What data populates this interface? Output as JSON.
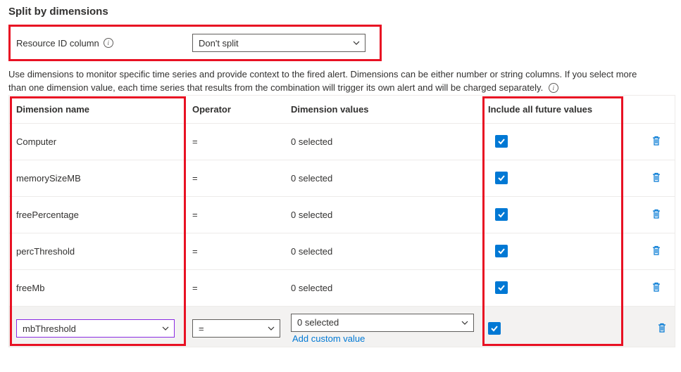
{
  "section_title": "Split by dimensions",
  "resource_id_label": "Resource ID column",
  "resource_id_value": "Don't split",
  "help_text_1": "Use dimensions to monitor specific time series and provide context to the fired alert. Dimensions can be either number or string columns. If you select more",
  "help_text_2": "than one dimension value, each time series that results from the combination will trigger its own alert and will be charged separately.",
  "headers": {
    "name": "Dimension name",
    "operator": "Operator",
    "values": "Dimension values",
    "include": "Include all future values"
  },
  "rows": [
    {
      "name": "Computer",
      "operator": "=",
      "values": "0 selected",
      "include": true
    },
    {
      "name": "memorySizeMB",
      "operator": "=",
      "values": "0 selected",
      "include": true
    },
    {
      "name": "freePercentage",
      "operator": "=",
      "values": "0 selected",
      "include": true
    },
    {
      "name": "percThreshold",
      "operator": "=",
      "values": "0 selected",
      "include": true
    },
    {
      "name": "freeMb",
      "operator": "=",
      "values": "0 selected",
      "include": true
    }
  ],
  "edit_row": {
    "name": "mbThreshold",
    "operator": "=",
    "values": "0 selected",
    "include": true,
    "add_custom": "Add custom value"
  }
}
